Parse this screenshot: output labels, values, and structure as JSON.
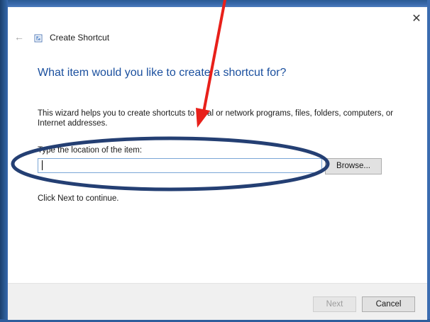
{
  "window": {
    "close_glyph": "✕",
    "back_glyph": "←",
    "app_title": "Create Shortcut"
  },
  "wizard": {
    "heading": "What item would you like to create a shortcut for?",
    "description": "This wizard helps you to create shortcuts to local or network programs, files, folders, computers, or Internet addresses.",
    "location_label": "Type the location of the item:",
    "location_value": "",
    "browse_label": "Browse...",
    "continue_text": "Click Next to continue."
  },
  "footer": {
    "next_label": "Next",
    "cancel_label": "Cancel"
  },
  "colors": {
    "heading": "#1a4f9e",
    "annotation_arrow": "#e8201a",
    "annotation_ellipse": "#243f73"
  }
}
